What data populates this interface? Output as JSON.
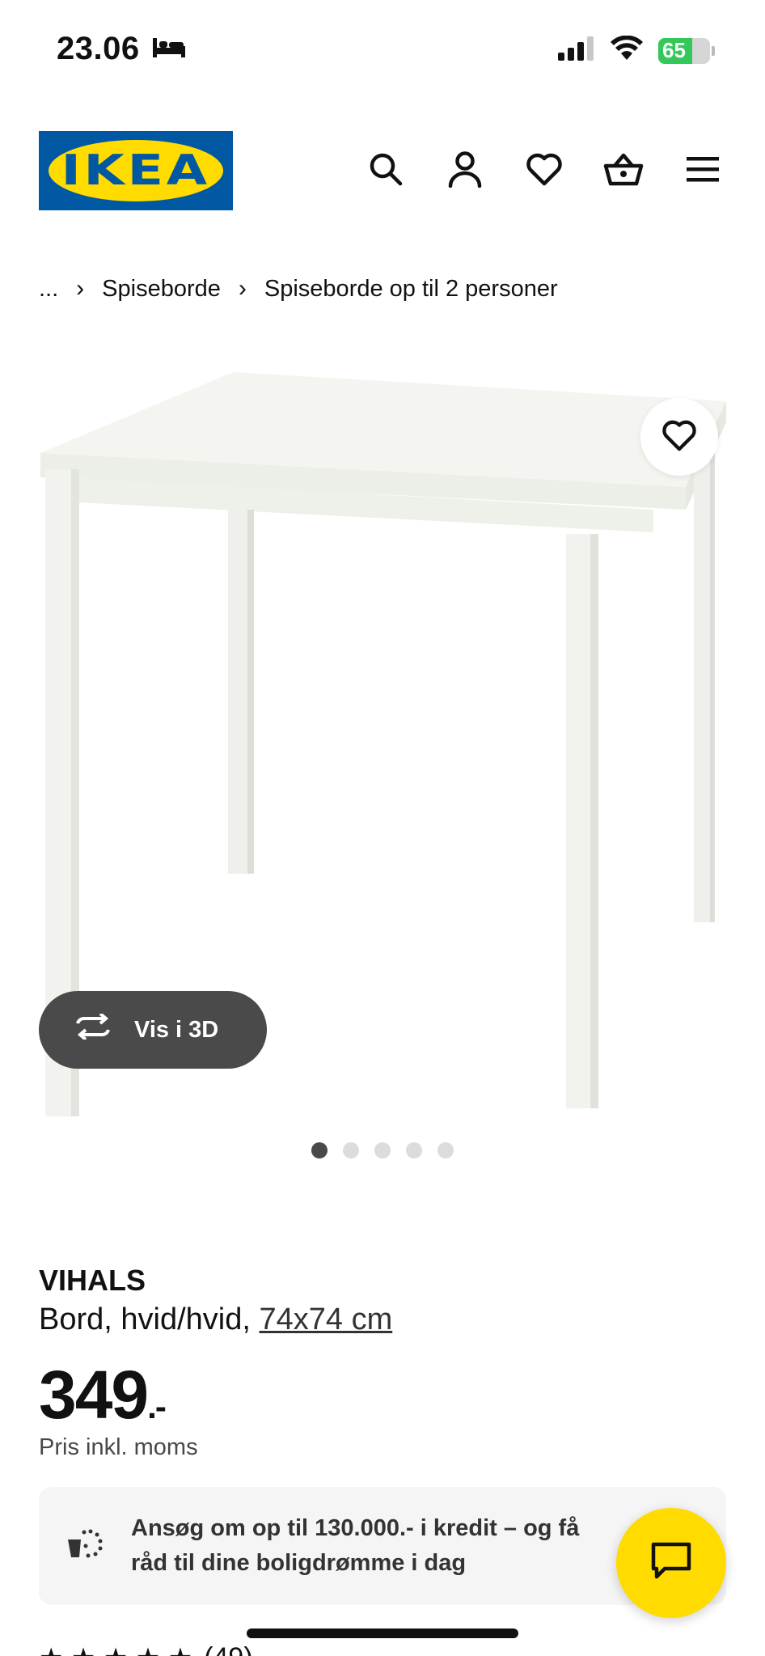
{
  "status_bar": {
    "time": "23.06",
    "battery_level": "65"
  },
  "header": {
    "logo_text": "IKEA",
    "icons": [
      "search-icon",
      "account-icon",
      "heart-icon",
      "basket-icon",
      "menu-icon"
    ]
  },
  "breadcrumb": {
    "items": [
      "...",
      "Spiseborde",
      "Spiseborde op til 2 personer"
    ],
    "separator": "›"
  },
  "gallery": {
    "view_3d_label": "Vis i 3D",
    "dot_count": 5,
    "active_index": 0
  },
  "product": {
    "name": "VIHALS",
    "description": "Bord, hvid/hvid, ",
    "size": "74x74 cm",
    "price": "349",
    "price_suffix": ".-",
    "vat_note": "Pris inkl. moms"
  },
  "credit": {
    "text": "Ansøg om op til 130.000.- i kredit – og få råd til dine boligdrømme i dag"
  },
  "rating": {
    "count_text": "(49)"
  },
  "colors": {
    "brand_blue": "#0058a3",
    "brand_yellow": "#ffdb00",
    "battery_green": "#34c759",
    "button_dark": "#4a4a4a"
  }
}
